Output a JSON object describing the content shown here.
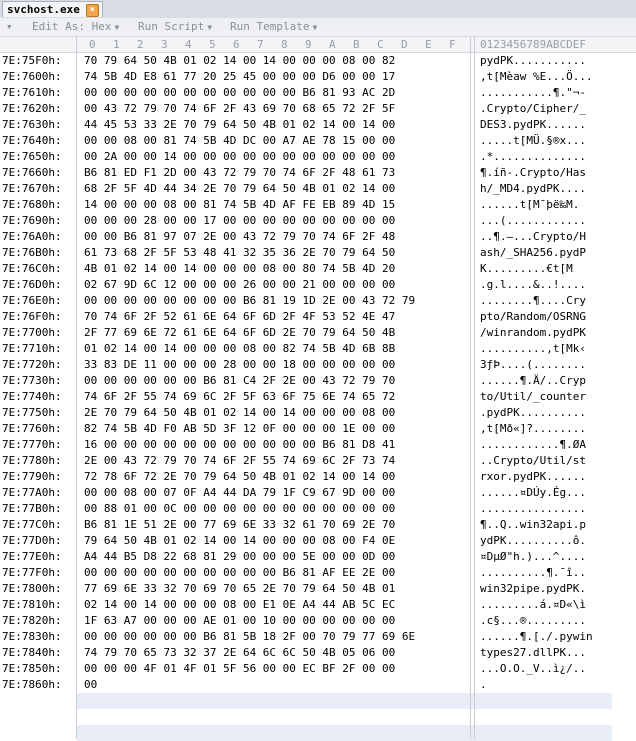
{
  "tab": {
    "title": "svchost.exe"
  },
  "toolbar": {
    "edit_as": "Edit As: Hex",
    "run_script": "Run Script",
    "run_template": "Run Template"
  },
  "column_header": {
    "hex_columns": [
      "0",
      "1",
      "2",
      "3",
      "4",
      "5",
      "6",
      "7",
      "8",
      "9",
      "A",
      "B",
      "C",
      "D",
      "E",
      "F"
    ],
    "ascii_header": "0123456789ABCDEF"
  },
  "rows": [
    {
      "addr": "7E:75F0h:",
      "hex": "70 79 64 50 4B 01 02 14 00 14 00 00 00 08 00 82",
      "ascii": "pydPK..........."
    },
    {
      "addr": "7E:7600h:",
      "hex": "74 5B 4D E8 61 77 20 25 45 00 00 00 D6 00 00 17",
      "ascii": ",t[Mèaw %E...Ö..."
    },
    {
      "addr": "7E:7610h:",
      "hex": "00 00 00 00 00 00 00 00 00 00 00 B6 81 93 AC 2D",
      "ascii": "...........¶.\"¬-"
    },
    {
      "addr": "7E:7620h:",
      "hex": "00 43 72 79 70 74 6F 2F 43 69 70 68 65 72 2F 5F",
      "ascii": ".Crypto/Cipher/_"
    },
    {
      "addr": "7E:7630h:",
      "hex": "44 45 53 33 2E 70 79 64 50 4B 01 02 14 00 14 00",
      "ascii": "DES3.pydPK......"
    },
    {
      "addr": "7E:7640h:",
      "hex": "00 00 08 00 81 74 5B 4D DC 00 A7 AE 78 15 00 00",
      "ascii": ".....t[MÜ.§®x..."
    },
    {
      "addr": "7E:7650h:",
      "hex": "00 2A 00 00 14 00 00 00 00 00 00 00 00 00 00 00",
      "ascii": ".*.............."
    },
    {
      "addr": "7E:7660h:",
      "hex": "B6 81 ED F1 2D 00 43 72 79 70 74 6F 2F 48 61 73",
      "ascii": "¶.íñ-.Crypto/Has"
    },
    {
      "addr": "7E:7670h:",
      "hex": "68 2F 5F 4D 44 34 2E 70 79 64 50 4B 01 02 14 00",
      "ascii": "h/_MD4.pydPK...."
    },
    {
      "addr": "7E:7680h:",
      "hex": "14 00 00 00 08 00 81 74 5B 4D AF FE EB 89 4D 15",
      "ascii": "......t[M¯þë‰M."
    },
    {
      "addr": "7E:7690h:",
      "hex": "00 00 00 28 00 00 17 00 00 00 00 00 00 00 00 00",
      "ascii": "...(............"
    },
    {
      "addr": "7E:76A0h:",
      "hex": "00 00 B6 81 97 07 2E 00 43 72 79 70 74 6F 2F 48",
      "ascii": "..¶.—...Crypto/H"
    },
    {
      "addr": "7E:76B0h:",
      "hex": "61 73 68 2F 5F 53 48 41 32 35 36 2E 70 79 64 50",
      "ascii": "ash/_SHA256.pydP"
    },
    {
      "addr": "7E:76C0h:",
      "hex": "4B 01 02 14 00 14 00 00 00 08 00 80 74 5B 4D 20",
      "ascii": "K.........€t[M "
    },
    {
      "addr": "7E:76D0h:",
      "hex": "02 67 9D 6C 12 00 00 00 26 00 00 21 00 00 00 00",
      "ascii": ".g.l....&..!...."
    },
    {
      "addr": "7E:76E0h:",
      "hex": "00 00 00 00 00 00 00 00 B6 81 19 1D 2E 00 43 72 79",
      "ascii": "........¶....Cry"
    },
    {
      "addr": "7E:76F0h:",
      "hex": "70 74 6F 2F 52 61 6E 64 6F 6D 2F 4F 53 52 4E 47",
      "ascii": "pto/Random/OSRNG"
    },
    {
      "addr": "7E:7700h:",
      "hex": "2F 77 69 6E 72 61 6E 64 6F 6D 2E 70 79 64 50 4B",
      "ascii": "/winrandom.pydPK"
    },
    {
      "addr": "7E:7710h:",
      "hex": "01 02 14 00 14 00 00 00 08 00 82 74 5B 4D 6B 8B",
      "ascii": "..........,t[Mk‹"
    },
    {
      "addr": "7E:7720h:",
      "hex": "33 83 DE 11 00 00 00 28 00 00 18 00 00 00 00 00",
      "ascii": "3ƒÞ....(........"
    },
    {
      "addr": "7E:7730h:",
      "hex": "00 00 00 00 00 00 B6 81 C4 2F 2E 00 43 72 79 70",
      "ascii": "......¶.Ä/..Cryp"
    },
    {
      "addr": "7E:7740h:",
      "hex": "74 6F 2F 55 74 69 6C 2F 5F 63 6F 75 6E 74 65 72",
      "ascii": "to/Util/_counter"
    },
    {
      "addr": "7E:7750h:",
      "hex": "2E 70 79 64 50 4B 01 02 14 00 14 00 00 00 08 00",
      "ascii": ".pydPK.........."
    },
    {
      "addr": "7E:7760h:",
      "hex": "82 74 5B 4D F0 AB 5D 3F 12 0F 00 00 00 1E 00 00",
      "ascii": ",t[Mð«]?........"
    },
    {
      "addr": "7E:7770h:",
      "hex": "16 00 00 00 00 00 00 00 00 00 00 00 B6 81 D8 41",
      "ascii": "............¶.ØA"
    },
    {
      "addr": "7E:7780h:",
      "hex": "2E 00 43 72 79 70 74 6F 2F 55 74 69 6C 2F 73 74",
      "ascii": "..Crypto/Util/st"
    },
    {
      "addr": "7E:7790h:",
      "hex": "72 78 6F 72 2E 70 79 64 50 4B 01 02 14 00 14 00",
      "ascii": "rxor.pydPK......"
    },
    {
      "addr": "7E:77A0h:",
      "hex": "00 00 08 00 07 0F A4 44 DA 79 1F C9 67 9D 00 00",
      "ascii": "......¤DÚy.Ég..."
    },
    {
      "addr": "7E:77B0h:",
      "hex": "00 88 01 00 0C 00 00 00 00 00 00 00 00 00 00 00",
      "ascii": "................"
    },
    {
      "addr": "7E:77C0h:",
      "hex": "B6 81 1E 51 2E 00 77 69 6E 33 32 61 70 69 2E 70",
      "ascii": "¶..Q..win32api.p"
    },
    {
      "addr": "7E:77D0h:",
      "hex": "79 64 50 4B 01 02 14 00 14 00 00 00 08 00 F4 0E",
      "ascii": "ydPK..........ô."
    },
    {
      "addr": "7E:77E0h:",
      "hex": "A4 44 B5 D8 22 68 81 29 00 00 00 5E 00 00 0D 00",
      "ascii": "¤DµØ\"h.)...^...."
    },
    {
      "addr": "7E:77F0h:",
      "hex": "00 00 00 00 00 00 00 00 00 00 B6 81 AF EE 2E 00",
      "ascii": "..........¶.¯î.."
    },
    {
      "addr": "7E:7800h:",
      "hex": "77 69 6E 33 32 70 69 70 65 2E 70 79 64 50 4B 01",
      "ascii": "win32pipe.pydPK."
    },
    {
      "addr": "7E:7810h:",
      "hex": "02 14 00 14 00 00 00 08 00 E1 0E A4 44 AB 5C EC",
      "ascii": ".........á.¤D«\\ì"
    },
    {
      "addr": "7E:7820h:",
      "hex": "1F 63 A7 00 00 00 AE 01 00 10 00 00 00 00 00 00",
      "ascii": ".c§...®........."
    },
    {
      "addr": "7E:7830h:",
      "hex": "00 00 00 00 00 00 B6 81 5B 18 2F 00 70 79 77 69 6E",
      "ascii": "......¶.[./.pywin"
    },
    {
      "addr": "7E:7840h:",
      "hex": "74 79 70 65 73 32 37 2E 64 6C 6C 50 4B 05 06 00",
      "ascii": "types27.dllPK..."
    },
    {
      "addr": "7E:7850h:",
      "hex": "00 00 00 4F 01 4F 01 5F 56 00 00 EC BF 2F 00 00",
      "ascii": "...O.O._V..ì¿/.."
    },
    {
      "addr": "7E:7860h:",
      "hex": "00",
      "ascii": "."
    }
  ]
}
